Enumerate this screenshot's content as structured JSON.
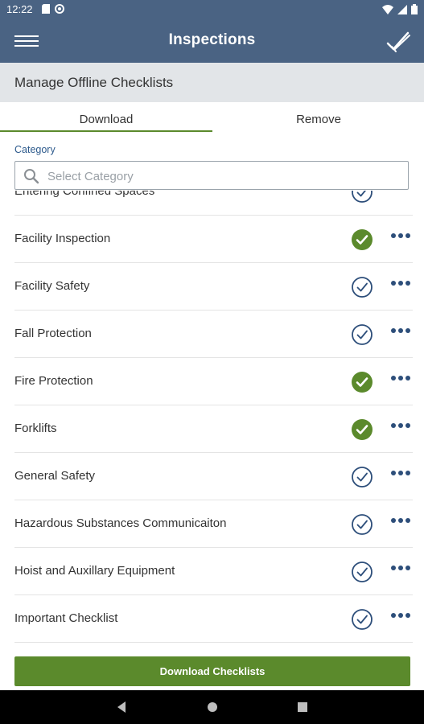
{
  "status_bar": {
    "time": "12:22"
  },
  "app_bar": {
    "title": "Inspections"
  },
  "sub_header": {
    "title": "Manage Offline Checklists"
  },
  "tabs": [
    {
      "label": "Download",
      "active": true
    },
    {
      "label": "Remove",
      "active": false
    }
  ],
  "category": {
    "label": "Category",
    "placeholder": "Select Category"
  },
  "checklists": [
    {
      "name": "Entering Confined Spaces",
      "status": "outline"
    },
    {
      "name": "Facility Inspection",
      "status": "filled"
    },
    {
      "name": "Facility Safety",
      "status": "outline"
    },
    {
      "name": "Fall Protection",
      "status": "outline"
    },
    {
      "name": "Fire Protection",
      "status": "filled"
    },
    {
      "name": "Forklifts",
      "status": "filled"
    },
    {
      "name": "General Safety",
      "status": "outline"
    },
    {
      "name": "Hazardous Substances Communicaiton",
      "status": "outline"
    },
    {
      "name": "Hoist and Auxillary Equipment",
      "status": "outline"
    },
    {
      "name": "Important Checklist",
      "status": "outline"
    }
  ],
  "footer": {
    "download_button": "Download Checklists"
  },
  "colors": {
    "header": "#4a6383",
    "accent_green": "#5b8a2c",
    "icon_blue": "#2d4e7a"
  }
}
